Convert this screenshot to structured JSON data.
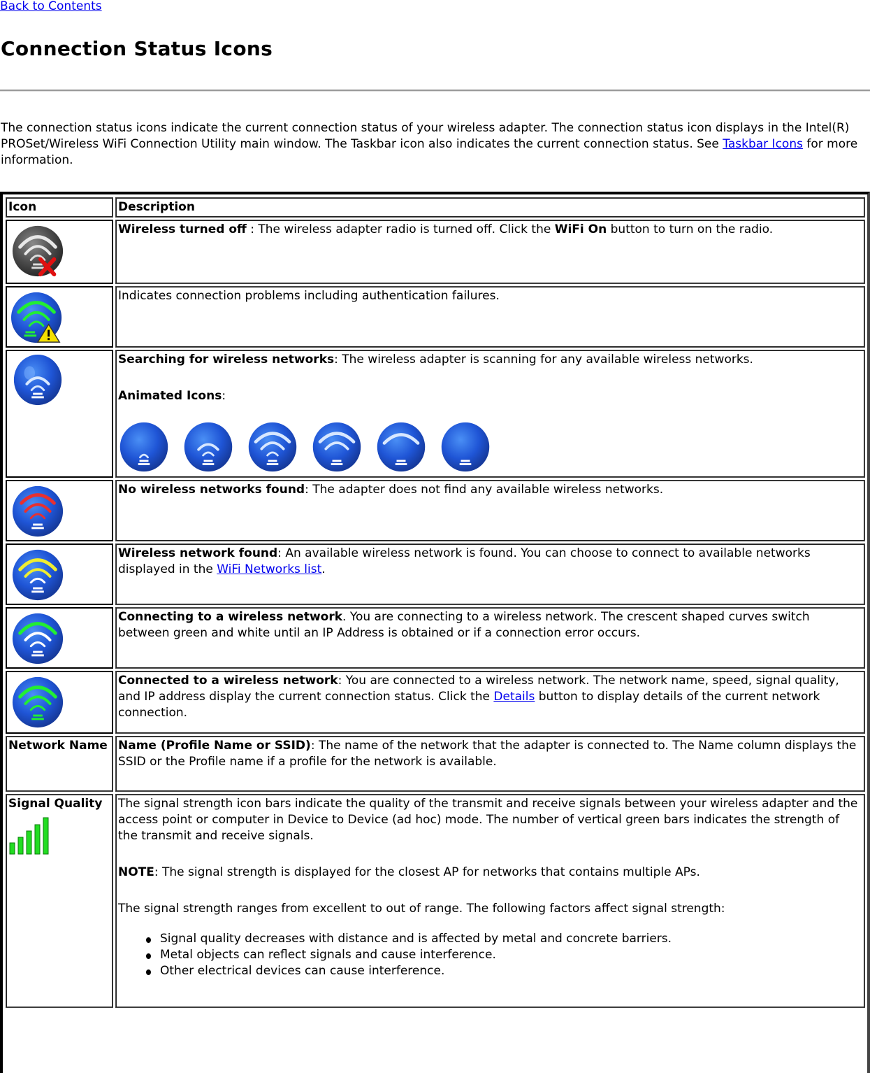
{
  "nav": {
    "back_link": "Back to Contents"
  },
  "page_title": "Connection Status Icons",
  "intro": {
    "text_before_link": "The connection status icons indicate the current connection status of your wireless adapter. The connection status icon displays in the Intel(R) PROSet/Wireless WiFi Connection Utility main window. The Taskbar icon also indicates the current connection status. See ",
    "link": "Taskbar Icons",
    "text_after_link": " for more information."
  },
  "table": {
    "headers": {
      "icon": "Icon",
      "description": "Description"
    },
    "rows": [
      {
        "icon": "wifi-off-icon",
        "title": "Wireless turned off",
        "sep": " : ",
        "text": "The wireless adapter radio is turned off. Click the ",
        "bold2": "WiFi On",
        "text2": " button to turn on the radio."
      },
      {
        "icon": "wifi-warning-icon",
        "text": "Indicates connection problems including authentication failures."
      },
      {
        "icon": "wifi-searching-icon",
        "title": "Searching for wireless networks",
        "sep": ": ",
        "text": "The wireless adapter is scanning for any available wireless networks.",
        "animated_label": "Animated Icons",
        "animated_sep": ":",
        "animated_frames": [
          "frame-1",
          "frame-2",
          "frame-3",
          "frame-4",
          "frame-5",
          "frame-6"
        ]
      },
      {
        "icon": "wifi-no-networks-icon",
        "title": "No wireless networks found",
        "sep": ": ",
        "text": "The adapter does not find any available wireless networks."
      },
      {
        "icon": "wifi-found-icon",
        "title": "Wireless network found",
        "sep": ": ",
        "text": "An available wireless network is found. You can choose to connect to available networks displayed in the ",
        "link": "WiFi Networks list",
        "text2": "."
      },
      {
        "icon": "wifi-connecting-icon",
        "title": "Connecting to a wireless network",
        "sep": ". ",
        "text": "You are connecting to a wireless network. The crescent shaped curves switch between green and white until an IP Address is obtained or if a connection error occurs."
      },
      {
        "icon": "wifi-connected-icon",
        "title": "Connected to a wireless network",
        "sep": ": ",
        "text": "You are connected to a wireless network. The network name, speed, signal quality, and IP address display the current connection status. Click the ",
        "link": "Details",
        "text2": " button to display details of the current network connection."
      },
      {
        "label": "Network Name",
        "title": "Name (Profile Name or SSID)",
        "sep": ": ",
        "text": "The name of the network that the adapter is connected to. The Name column displays the SSID or the Profile name if a profile for the network is available."
      },
      {
        "label": "Signal Quality",
        "icon": "signal-bars-icon",
        "text": "The signal strength icon bars indicate the quality of the transmit and receive signals between your wireless adapter and the access point or computer in Device to Device (ad hoc) mode. The number of vertical green bars indicates the strength of the transmit and receive signals.",
        "note_label": "NOTE",
        "note_text": ": The signal strength is displayed for the closest AP for networks that contains multiple APs.",
        "range_text": "The signal strength ranges from excellent to out of range. The following factors affect signal strength:",
        "factors": [
          "Signal quality decreases with distance and is affected by metal and concrete barriers.",
          "Metal objects can reflect signals and cause interference.",
          "Other electrical devices can cause interference."
        ]
      }
    ]
  },
  "colors": {
    "link": "#0000ee",
    "icon_blue": "#1f4fcf",
    "icon_gray": "#4a4a4a",
    "arc_green": "#22ee33",
    "arc_yellow": "#f0ee30",
    "arc_red": "#e83030",
    "arc_white": "#ffffff",
    "error_red": "#e01010",
    "warning_yellow": "#f5e000"
  }
}
